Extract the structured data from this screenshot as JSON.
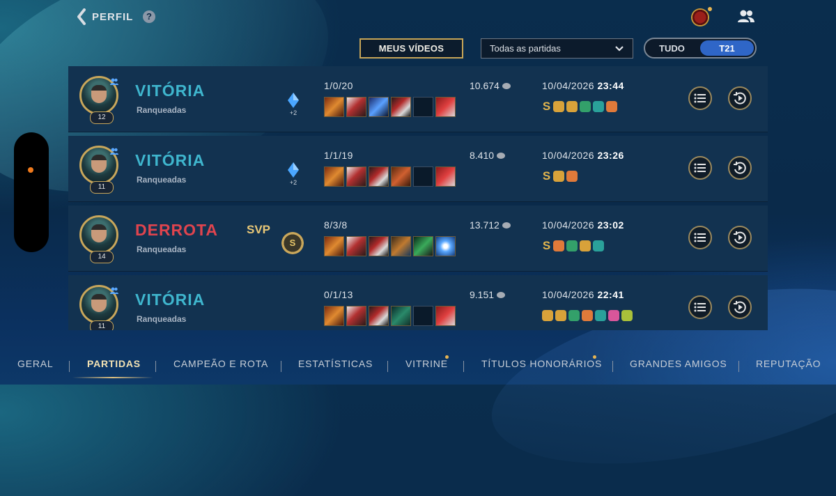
{
  "header": {
    "back_label": "PERFIL",
    "help_label": "?"
  },
  "controls": {
    "my_videos_label": "MEUS VÍDEOS",
    "filter_value": "Todas as partidas",
    "segment": {
      "options": [
        "TUDO",
        "T21"
      ],
      "selected": "T21"
    }
  },
  "matches": [
    {
      "result": "VITÓRIA",
      "outcome": "win",
      "mode": "Ranqueadas",
      "level": "12",
      "gem_bonus": "+2",
      "kda": "1/0/20",
      "gold": "10.674",
      "date": "10/04/2026",
      "time": "23:44"
    },
    {
      "result": "VITÓRIA",
      "outcome": "win",
      "mode": "Ranqueadas",
      "level": "11",
      "gem_bonus": "+2",
      "kda": "1/1/19",
      "gold": "8.410",
      "date": "10/04/2026",
      "time": "23:26"
    },
    {
      "result": "DERROTA",
      "outcome": "loss",
      "mode": "Ranqueadas",
      "level": "14",
      "svp_label": "SVP",
      "svp_medal": "S",
      "kda": "8/3/8",
      "gold": "13.712",
      "date": "10/04/2026",
      "time": "23:02"
    },
    {
      "result": "VITÓRIA",
      "outcome": "win",
      "mode": "Ranqueadas",
      "level": "11",
      "kda": "0/1/13",
      "gold": "9.151",
      "date": "10/04/2026",
      "time": "22:41"
    }
  ],
  "badge_rank": "S",
  "tabs": [
    "GERAL",
    "PARTIDAS",
    "CAMPEÃO E ROTA",
    "ESTATÍSTICAS",
    "VITRINE",
    "TÍTULOS HONORÁRIOS",
    "GRANDES AMIGOS",
    "REPUTAÇÃO"
  ],
  "active_tab": "PARTIDAS",
  "colors": {
    "win": "#3fb6ce",
    "loss": "#e0444e",
    "accent_gold": "#c7a557",
    "segment_active": "#2f66c7"
  }
}
